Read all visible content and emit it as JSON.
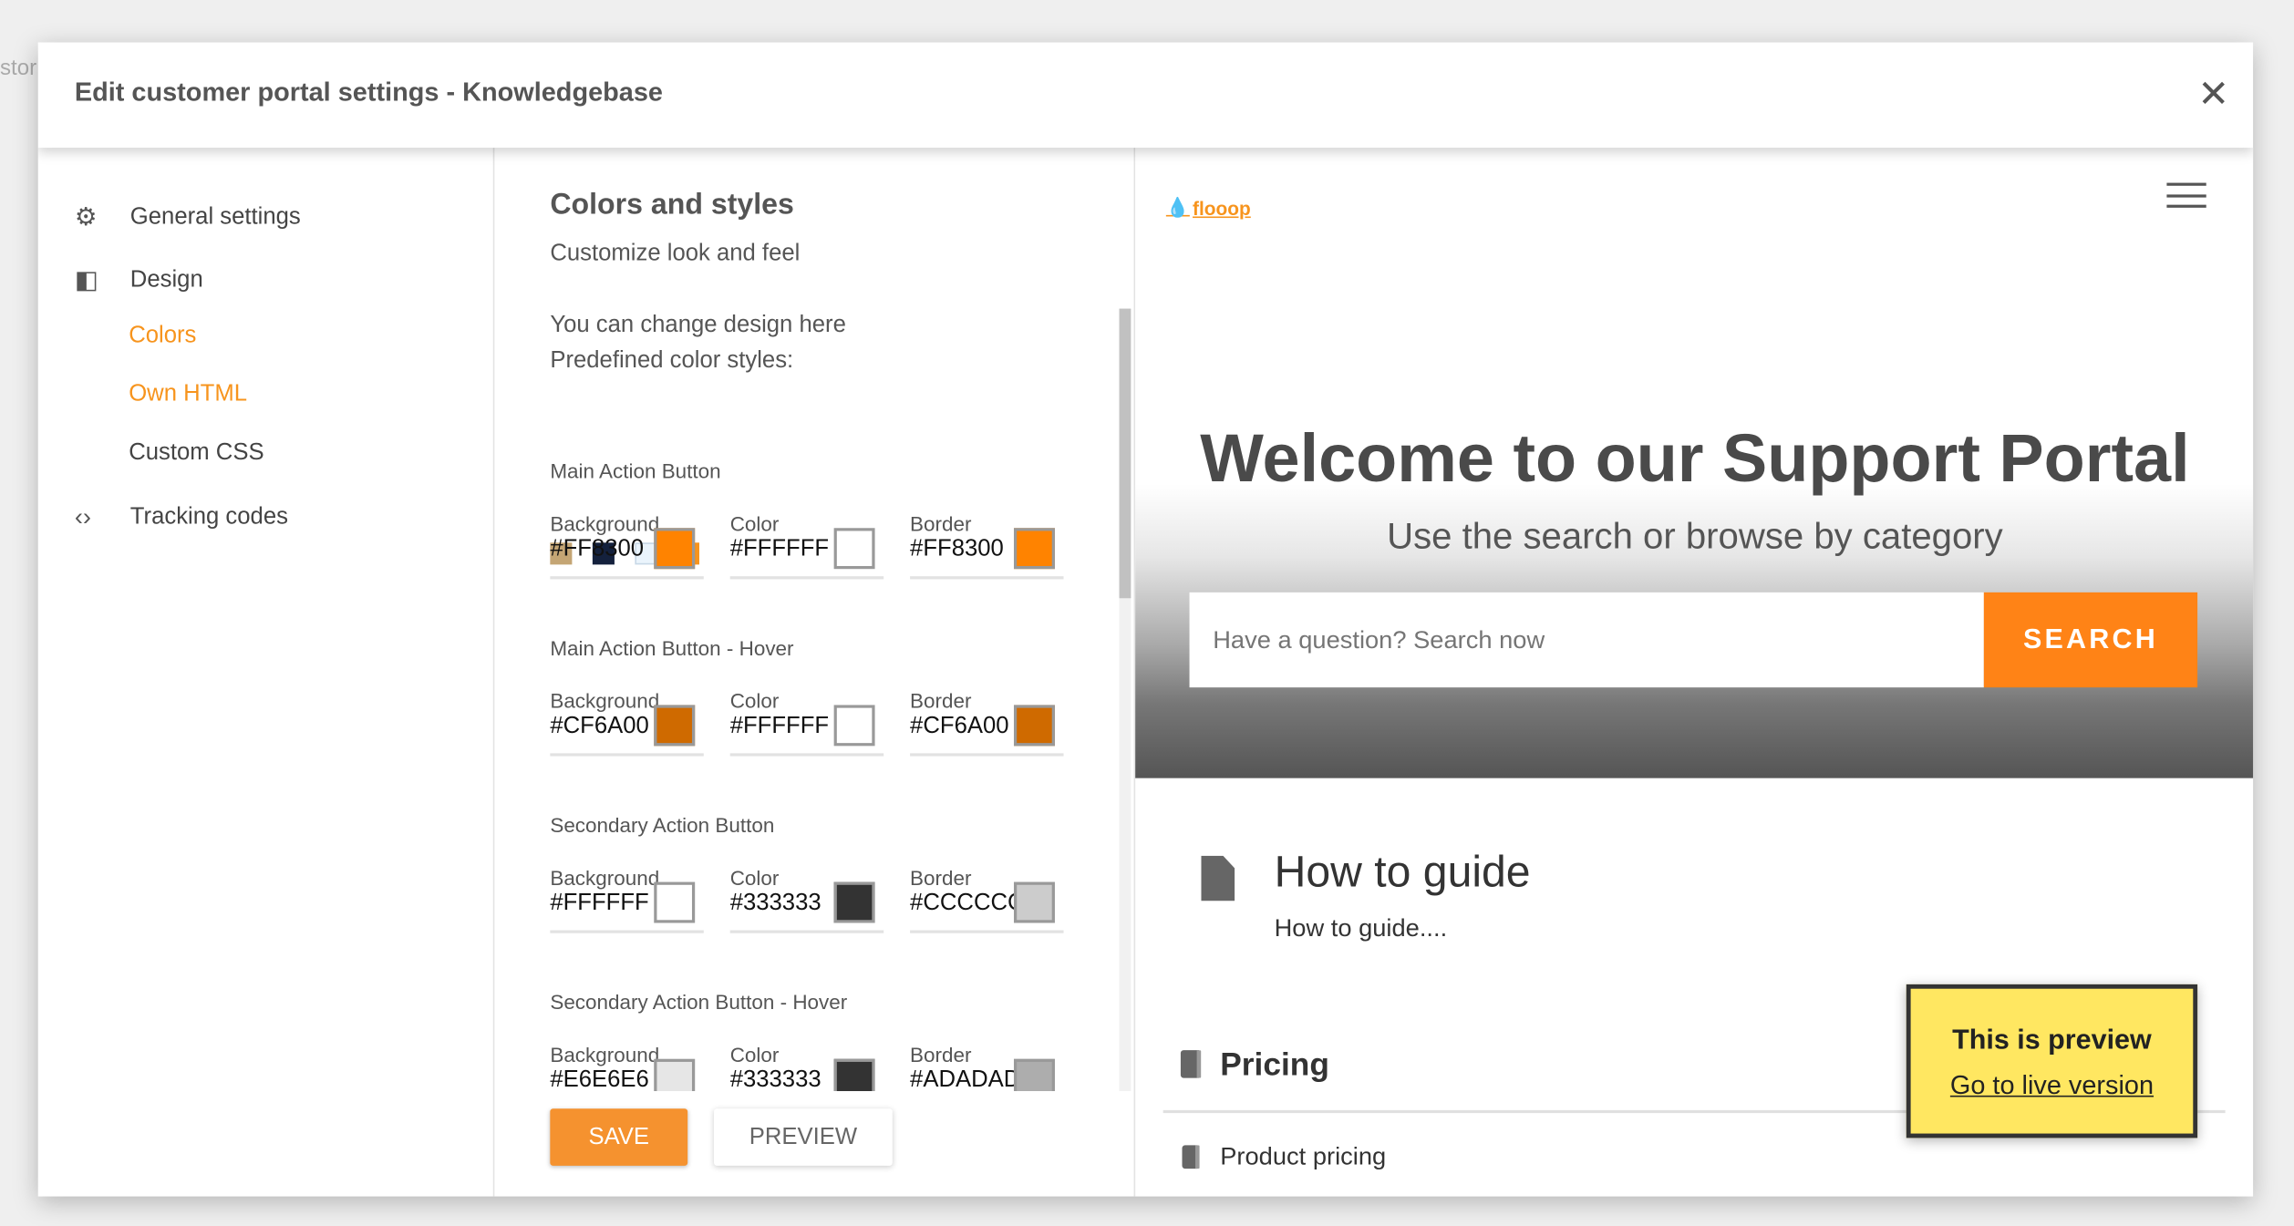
{
  "background": {
    "partial_text": "stor"
  },
  "header": {
    "title": "Edit customer portal settings - Knowledgebase",
    "close": "✕"
  },
  "nav": {
    "general": "General settings",
    "design": "Design",
    "colors": "Colors",
    "own_html": "Own HTML",
    "custom_css": "Custom CSS",
    "tracking": "Tracking codes",
    "accent": "#f7941d"
  },
  "main": {
    "title": "Colors and styles",
    "subtitle": "Customize look and feel",
    "intro1": "You can change design here",
    "intro2": "Predefined color styles:",
    "predefined": [
      "#c4a574",
      "#14213d",
      "#eaf4fc",
      "#f7941d"
    ],
    "sections": [
      {
        "title": "Main Action Button",
        "fields": [
          {
            "label": "Background",
            "value": "#FF8300",
            "swatch": "#FF8300"
          },
          {
            "label": "Color",
            "value": "#FFFFFF",
            "swatch": "#FFFFFF"
          },
          {
            "label": "Border",
            "value": "#FF8300",
            "swatch": "#FF8300"
          }
        ]
      },
      {
        "title": "Main Action Button - Hover",
        "fields": [
          {
            "label": "Background",
            "value": "#CF6A00",
            "swatch": "#CF6A00"
          },
          {
            "label": "Color",
            "value": "#FFFFFF",
            "swatch": "#FFFFFF"
          },
          {
            "label": "Border",
            "value": "#CF6A00",
            "swatch": "#CF6A00"
          }
        ]
      },
      {
        "title": "Secondary Action Button",
        "fields": [
          {
            "label": "Background",
            "value": "#FFFFFF",
            "swatch": "#FFFFFF"
          },
          {
            "label": "Color",
            "value": "#333333",
            "swatch": "#333333"
          },
          {
            "label": "Border",
            "value": "#CCCCCC",
            "swatch": "#CCCCCC"
          }
        ]
      },
      {
        "title": "Secondary Action Button - Hover",
        "fields": [
          {
            "label": "Background",
            "value": "#E6E6E6",
            "swatch": "#E6E6E6"
          },
          {
            "label": "Color",
            "value": "#333333",
            "swatch": "#333333"
          },
          {
            "label": "Border",
            "value": "#ADADAD",
            "swatch": "#ADADAD"
          }
        ]
      }
    ],
    "save": "SAVE",
    "preview": "PREVIEW"
  },
  "preview": {
    "logo": "flooop",
    "hero_title": "Welcome to our Support Portal",
    "hero_subtitle": "Use the search or browse by category",
    "search_placeholder": "Have a question? Search now",
    "search_button": "SEARCH",
    "guide_title": "How to guide",
    "guide_desc": "How to guide....",
    "pricing": "Pricing",
    "product_pricing": "Product pricing",
    "notice_title": "This is preview",
    "notice_link": "Go to live version"
  }
}
